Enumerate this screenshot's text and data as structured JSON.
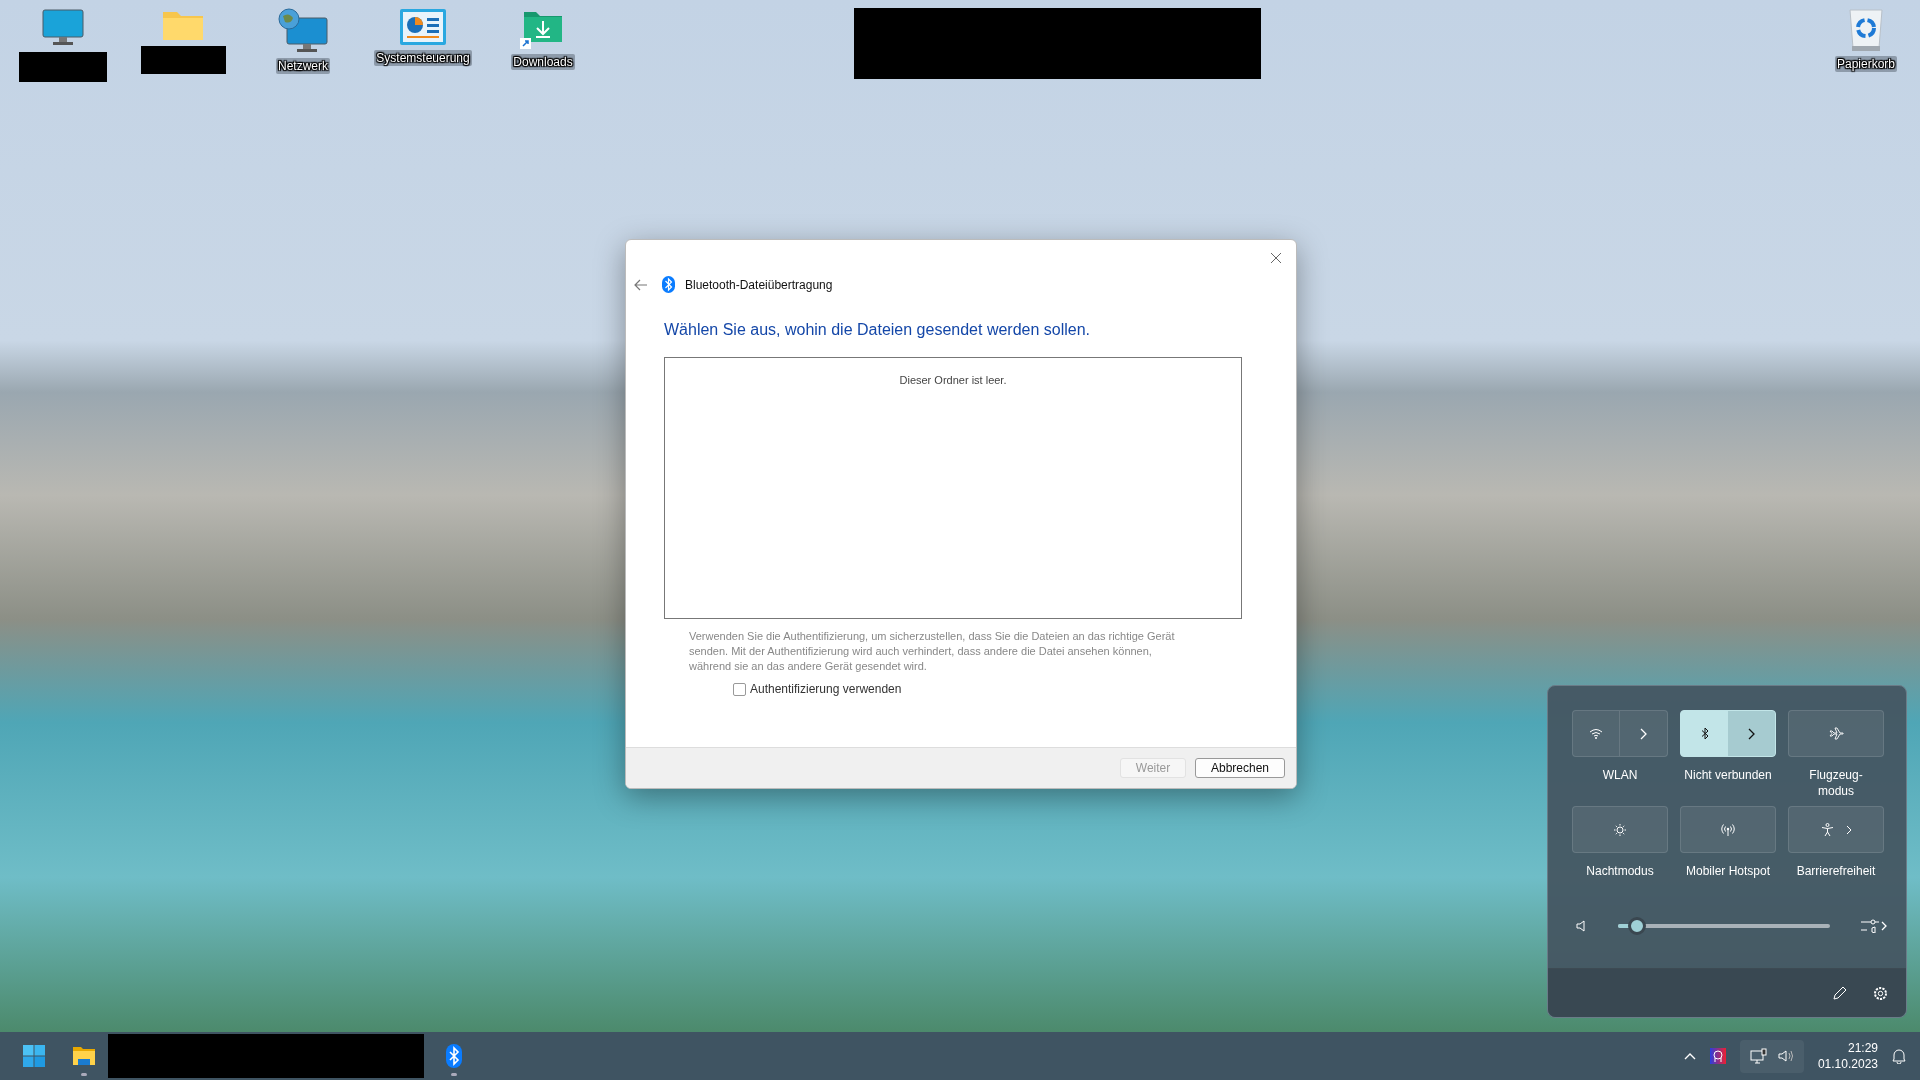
{
  "desktop_icons": [
    {
      "kind": "computer",
      "redacted": true
    },
    {
      "kind": "folder",
      "redacted": true
    },
    {
      "kind": "network",
      "label": "Netzwerk",
      "redacted": false
    },
    {
      "kind": "control-panel",
      "label": "Systemsteuerung",
      "redacted": false
    },
    {
      "kind": "downloads",
      "label": "Downloads",
      "redacted": false
    }
  ],
  "desktop_right_icon": {
    "kind": "recycle-bin",
    "label": "Papierkorb"
  },
  "top_redaction": true,
  "dialog": {
    "title": "Bluetooth-Dateiübertragung",
    "heading": "Wählen Sie aus, wohin die Dateien gesendet werden sollen.",
    "empty_text": "Dieser Ordner ist leer.",
    "description": "Verwenden Sie die Authentifizierung, um sicherzustellen, dass Sie die Dateien an das richtige Gerät senden. Mit der Authentifizierung wird auch verhindert, dass andere die Datei ansehen können, während sie an das andere Gerät gesendet wird.",
    "checkbox": {
      "label": "Authentifizierung verwenden",
      "checked": false
    },
    "buttons": [
      {
        "label": "Weiter",
        "disabled": true,
        "default": false
      },
      {
        "label": "Abbrechen",
        "disabled": false,
        "default": true
      }
    ]
  },
  "quick_settings": {
    "tiles": [
      {
        "kind": "wifi",
        "label": "WLAN",
        "on": false,
        "split": true,
        "chevron": false
      },
      {
        "kind": "bluetooth",
        "label": "Nicht verbunden",
        "on": true,
        "split": true,
        "chevron": false
      },
      {
        "kind": "airplane",
        "label": "Flugzeug-modus",
        "on": false,
        "split": false,
        "chevron": false
      },
      {
        "kind": "night",
        "label": "Nachtmodus",
        "on": false,
        "split": false,
        "chevron": false
      },
      {
        "kind": "hotspot",
        "label": "Mobiler Hotspot",
        "on": false,
        "split": false,
        "chevron": false
      },
      {
        "kind": "accessibility",
        "label": "Barrierefreiheit",
        "on": false,
        "split": false,
        "chevron": true
      }
    ],
    "volume": {
      "level": 0.08
    }
  },
  "taskbar": {
    "apps": [
      {
        "kind": "start",
        "running": false
      },
      {
        "kind": "explorer",
        "running": true
      },
      {
        "kind": "redacted"
      },
      {
        "kind": "bluetooth",
        "running": true
      }
    ],
    "time": "21:29",
    "date": "01.10.2023"
  }
}
